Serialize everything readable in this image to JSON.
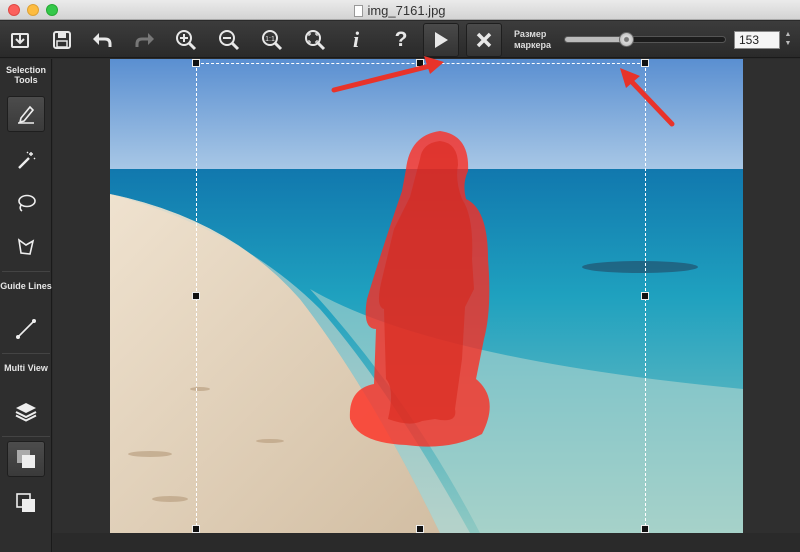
{
  "window": {
    "title": "img_7161.jpg"
  },
  "toolbar": {
    "buttons": [
      {
        "name": "export-button",
        "icon": "download-tray-icon"
      },
      {
        "name": "save-button",
        "icon": "floppy-icon"
      },
      {
        "name": "undo-button",
        "icon": "undo-arrow-icon"
      },
      {
        "name": "redo-button",
        "icon": "redo-arrow-icon"
      },
      {
        "name": "zoom-in-button",
        "icon": "zoom-in-icon"
      },
      {
        "name": "zoom-out-button",
        "icon": "zoom-out-icon"
      },
      {
        "name": "zoom-actual-button",
        "icon": "zoom-1to1-icon",
        "label": "1:1"
      },
      {
        "name": "zoom-fit-button",
        "icon": "zoom-fit-icon"
      },
      {
        "name": "info-button",
        "icon": "info-icon",
        "label": "i"
      },
      {
        "name": "help-button",
        "icon": "help-icon",
        "label": "?"
      },
      {
        "name": "run-button",
        "icon": "play-icon"
      },
      {
        "name": "cancel-button",
        "icon": "close-icon"
      }
    ],
    "marker_size": {
      "label": "Размер маркера",
      "value": "153",
      "level": 0.38
    }
  },
  "sidebar": {
    "selection_heading": "Selection Tools",
    "guide_heading": "Guide Lines",
    "multi_heading": "Multi View",
    "tools": [
      {
        "name": "marker-tool",
        "icon": "marker-pen-icon",
        "active": true
      },
      {
        "name": "magic-wand-tool",
        "icon": "magic-wand-icon"
      },
      {
        "name": "lasso-tool",
        "icon": "lasso-icon"
      },
      {
        "name": "polygon-lasso-tool",
        "icon": "polygon-lasso-icon"
      },
      {
        "name": "guide-line-tool",
        "icon": "line-icon"
      },
      {
        "name": "layers-view",
        "icon": "layers-icon"
      },
      {
        "name": "overlay-view",
        "icon": "overlay-squares-icon",
        "active": true
      },
      {
        "name": "outline-view",
        "icon": "outline-squares-icon"
      }
    ]
  },
  "colors": {
    "selection": "#ff2a1f",
    "arrow": "#e8332a",
    "sky": "#6f9fd6",
    "sea": "#1f8fb8",
    "sand": "#e3d3bd"
  }
}
